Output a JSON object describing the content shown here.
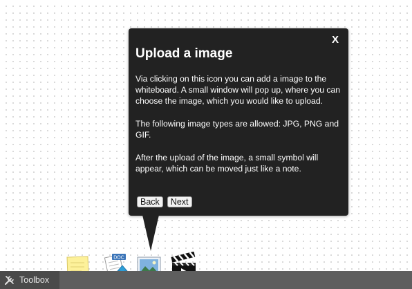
{
  "popover": {
    "close_label": "X",
    "title": "Upload a image",
    "paragraphs": [
      "Via clicking on this icon you can add a image to the whiteboard. A small window will pop up, where you can choose the image, which you would like to upload.",
      "The following image types are allowed: JPG, PNG and GIF.",
      "After the upload of the image, a small symbol will appear, which can be moved just like a note."
    ],
    "back_label": "Back",
    "next_label": "Next"
  },
  "toolbar": {
    "toolbox_label": "Toolbox",
    "tools": [
      {
        "name": "note",
        "icon": "sticky-note-icon"
      },
      {
        "name": "document",
        "icon": "document-upload-icon",
        "badge": "DOC"
      },
      {
        "name": "image",
        "icon": "image-icon"
      },
      {
        "name": "video",
        "icon": "clapperboard-icon"
      }
    ]
  },
  "colors": {
    "popover_bg": "#222222",
    "toolbar_bg": "#5e5e5e",
    "toolbox_tab_bg": "#4a4a4a",
    "note_yellow": "#fdf19a"
  }
}
